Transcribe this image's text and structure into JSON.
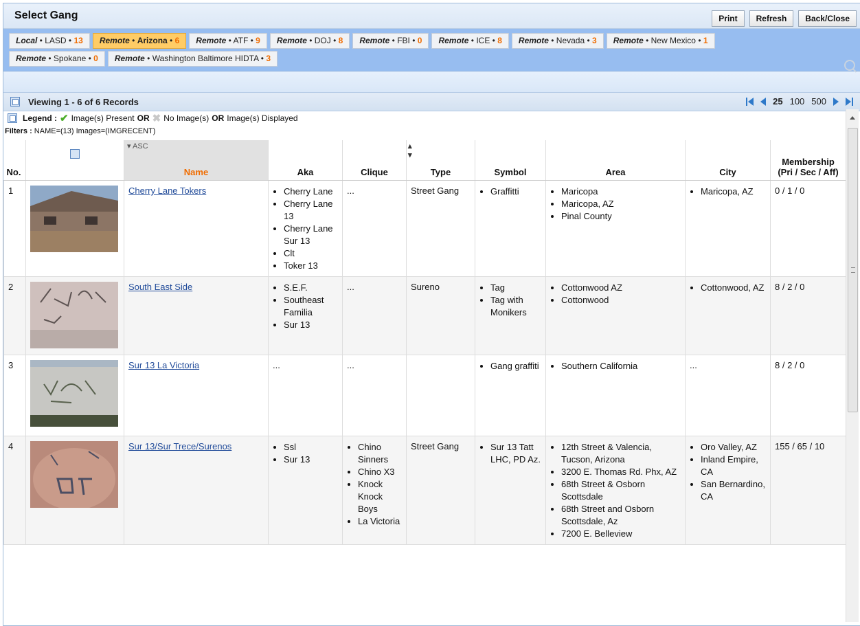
{
  "window": {
    "title": "Select Gang"
  },
  "toolbar": {
    "print_label": "Print",
    "refresh_label": "Refresh",
    "close_label": "Back/Close"
  },
  "tabs": [
    {
      "prefix": "Local",
      "name": "LASD",
      "count": "13",
      "active": false
    },
    {
      "prefix": "Remote",
      "name": "Arizona",
      "count": "6",
      "active": true
    },
    {
      "prefix": "Remote",
      "name": "ATF",
      "count": "9",
      "active": false
    },
    {
      "prefix": "Remote",
      "name": "DOJ",
      "count": "8",
      "active": false
    },
    {
      "prefix": "Remote",
      "name": "FBI",
      "count": "0",
      "active": false
    },
    {
      "prefix": "Remote",
      "name": "ICE",
      "count": "8",
      "active": false
    },
    {
      "prefix": "Remote",
      "name": "Nevada",
      "count": "3",
      "active": false
    },
    {
      "prefix": "Remote",
      "name": "New Mexico",
      "count": "1",
      "active": false
    },
    {
      "prefix": "Remote",
      "name": "Spokane",
      "count": "0",
      "active": false
    },
    {
      "prefix": "Remote",
      "name": "Washington Baltimore HIDTA",
      "count": "3",
      "active": false
    }
  ],
  "records": {
    "text": "Viewing 1 - 6 of 6 Records",
    "page_sizes": [
      "25",
      "100",
      "500"
    ],
    "selected_page_size": "25"
  },
  "legend": {
    "label": "Legend :",
    "present": "Image(s) Present",
    "or1": "OR",
    "none": "No Image(s)",
    "or2": "OR",
    "displayed": "Image(s) Displayed"
  },
  "filters": {
    "label": "Filters :",
    "value": "NAME=(13) Images=(IMGRECENT)"
  },
  "table": {
    "headers": {
      "no": "No.",
      "name": "Name",
      "name_sort": "ASC",
      "aka": "Aka",
      "clique": "Clique",
      "type": "Type",
      "symbol": "Symbol",
      "area": "Area",
      "city": "City",
      "membership": "Membership",
      "membership_sub": "(Pri / Sec / Aff)"
    },
    "rows": [
      {
        "no": "1",
        "name": "Cherry Lane Tokers",
        "aka": [
          "Cherry Lane",
          "Cherry Lane 13",
          "Cherry Lane Sur 13",
          "Clt",
          "Toker 13"
        ],
        "clique": "...",
        "clique_list": [],
        "type": "Street Gang",
        "symbol": [
          "Graffitti"
        ],
        "area": [
          "Maricopa",
          "Maricopa, AZ",
          "Pinal County"
        ],
        "city": [
          "Maricopa, AZ"
        ],
        "membership": "0 / 1 / 0"
      },
      {
        "no": "2",
        "name": "South East Side",
        "aka": [
          "S.E.F.",
          "Southeast Familia",
          "Sur 13"
        ],
        "clique": "...",
        "clique_list": [],
        "type": "Sureno",
        "symbol": [
          "Tag",
          "Tag with Monikers"
        ],
        "area": [
          "Cottonwood AZ",
          "Cottonwood"
        ],
        "city": [
          "Cottonwood, AZ"
        ],
        "membership": "8 / 2 / 0"
      },
      {
        "no": "3",
        "name": "Sur 13 La Victoria",
        "aka": [],
        "aka_text": "...",
        "clique": "...",
        "clique_list": [],
        "type": "",
        "symbol": [
          "Gang graffiti"
        ],
        "area": [
          "Southern California"
        ],
        "city": [],
        "city_text": "...",
        "membership": "8 / 2 / 0"
      },
      {
        "no": "4",
        "name": "Sur 13/Sur Trece/Surenos",
        "aka": [
          "Ssl",
          "Sur 13"
        ],
        "clique": "",
        "clique_list": [
          "Chino Sinners",
          "Chino X3",
          "Knock Knock Boys",
          "La Victoria"
        ],
        "type": "Street Gang",
        "symbol": [
          "Sur 13 Tatt LHC, PD Az."
        ],
        "area": [
          "12th Street & Valencia, Tucson, Arizona",
          "3200 E. Thomas Rd. Phx, AZ",
          "68th Street & Osborn Scottsdale",
          "68th Street and Osborn Scottsdale, Az",
          "7200 E. Belleview"
        ],
        "city": [
          "Oro Valley, AZ",
          "Inland Empire, CA",
          "San Bernardino, CA"
        ],
        "membership": "155 / 65 / 10"
      }
    ]
  },
  "colors": {
    "active_tab": "#ffcc66",
    "count": "#f06c00",
    "link": "#224c9a",
    "tab_band": "#97bdf0"
  }
}
